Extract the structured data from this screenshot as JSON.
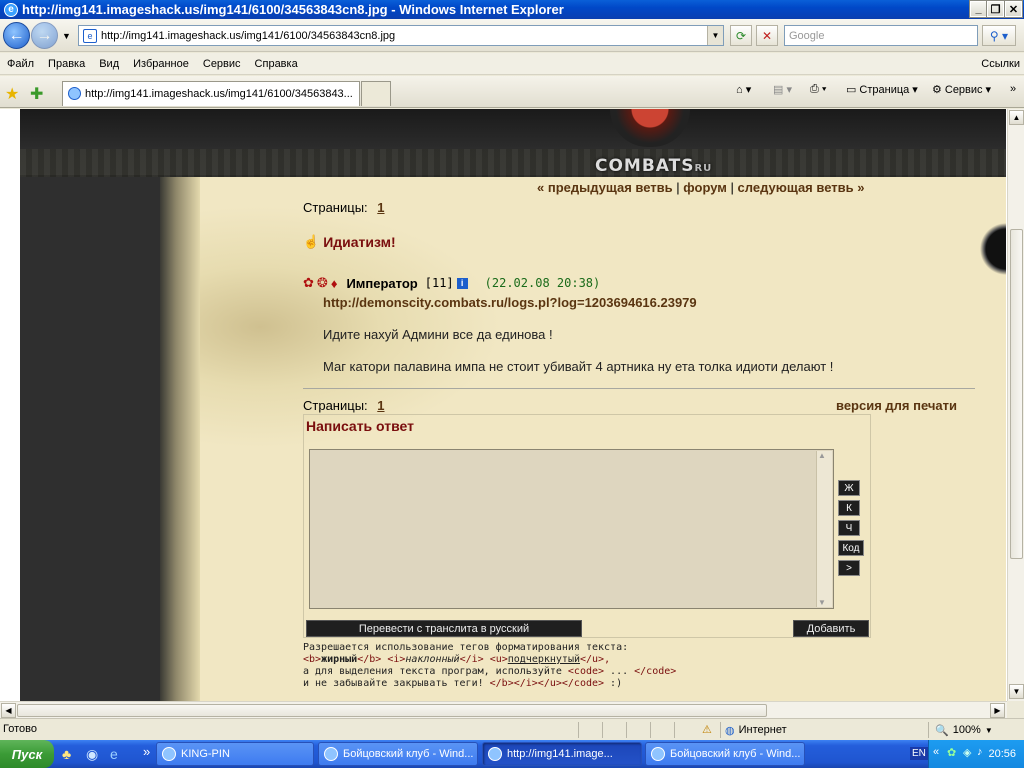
{
  "window": {
    "title": "http://img141.imageshack.us/img141/6100/34563843cn8.jpg - Windows Internet Explorer"
  },
  "address": {
    "url": "http://img141.imageshack.us/img141/6100/34563843cn8.jpg",
    "search_placeholder": "Google"
  },
  "menu": {
    "items": [
      "Файл",
      "Правка",
      "Вид",
      "Избранное",
      "Сервис",
      "Справка"
    ],
    "links": "Ссылки"
  },
  "tab": {
    "label": "http://img141.imageshack.us/img141/6100/34563843..."
  },
  "commands": {
    "page": "Страница",
    "service": "Сервис"
  },
  "site": {
    "logo": "COMBATS",
    "logo_suffix": "RU"
  },
  "nav": {
    "prev": "« предыдущая ветвь",
    "forum": "форум",
    "next": "следующая ветвь »",
    "sep": "|"
  },
  "pages": {
    "label": "Страницы:",
    "current": "1",
    "print": "версия для печати"
  },
  "thread": {
    "title": "Идиатизм!"
  },
  "post": {
    "author": "Император",
    "level": "[11]",
    "datetime": "(22.02.08 20:38)",
    "link": "http://demonscity.combats.ru/logs.pl?log=1203694616.23979",
    "line1": "Идите нахуй Админи все да единова !",
    "line2": "Маг катори палавина импа не стоит убивайт 4 артника ну ета толка идиоти делают !"
  },
  "reply": {
    "title": "Написать ответ",
    "fmt": [
      "Ж",
      "К",
      "Ч",
      "Код",
      ">"
    ],
    "translit": "Перевести с транслита в русский",
    "submit": "Добавить"
  },
  "help": {
    "line1": "Разрешается использование тегов форматирования текста:",
    "b_open": "<b>",
    "b_text": "жирный",
    "b_close": "</b>",
    "i_open": "<i>",
    "i_text": "наклонный",
    "i_close": "</i>",
    "u_open": "<u>",
    "u_text": "подчеркнутый",
    "u_close": "</u>,",
    "line3a": "а для выделения текста програм, используйте ",
    "code_open": "<code>",
    "dots": " ... ",
    "code_close": "</code>",
    "line4a": "и не забывайте закрывать теги! ",
    "closers": "</b></i></u></code>",
    "smile": " :)"
  },
  "status": {
    "text": "Готово",
    "zone": "Интернет",
    "zoom": "100%"
  },
  "taskbar": {
    "start": "Пуск",
    "tasks": [
      "KING-PIN",
      "Бойцовский клуб - Wind...",
      "http://img141.image...",
      "Бойцовский клуб - Wind..."
    ],
    "lang": "EN",
    "clock": "20:56"
  }
}
